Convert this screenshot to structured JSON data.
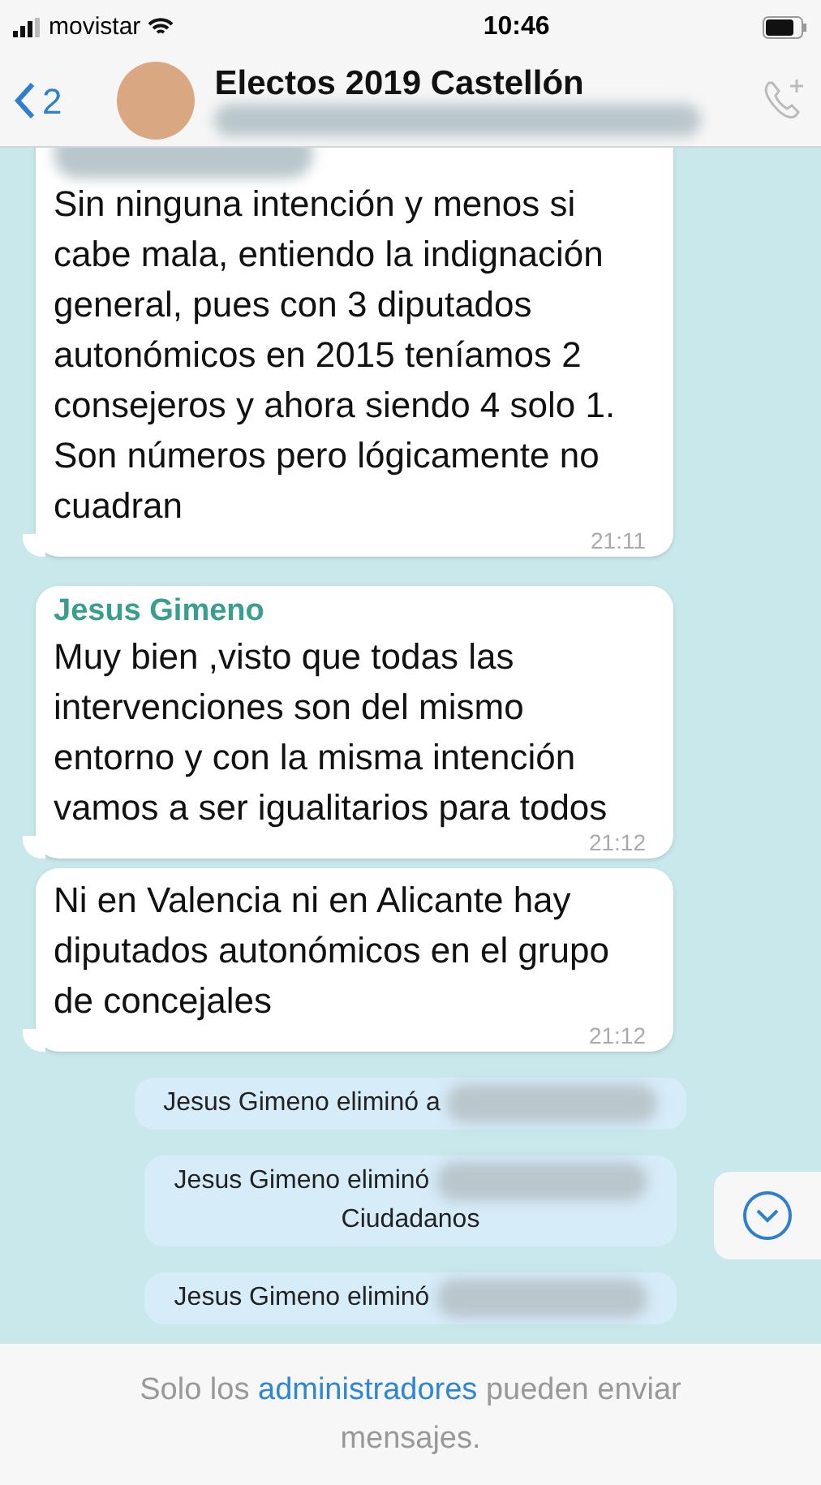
{
  "status_bar": {
    "carrier": "movistar",
    "time": "10:46"
  },
  "header": {
    "back_count": "2",
    "title": "Electos 2019 Castellón"
  },
  "messages": [
    {
      "kind": "incoming",
      "sender_hidden": true,
      "text": "Sin ninguna intención y menos si cabe mala, entiendo la indignación general, pues con 3 diputados autonómicos en 2015 teníamos 2 consejeros y ahora siendo 4 solo 1. Son números pero lógicamente no cuadran",
      "time": "21:11"
    },
    {
      "kind": "incoming",
      "sender": "Jesus Gimeno",
      "text": "Muy bien ,visto que todas las intervenciones son del mismo entorno y con la misma intención vamos a ser igualitarios para todos",
      "time": "21:12"
    },
    {
      "kind": "incoming",
      "text": "Ni en Valencia ni en Alicante hay diputados autonómicos en el grupo de concejales",
      "time": "21:12"
    },
    {
      "kind": "system",
      "text": "Jesus Gimeno eliminó a"
    },
    {
      "kind": "system",
      "text": "Jesus Gimeno eliminó",
      "second_line": "Ciudadanos"
    },
    {
      "kind": "system",
      "text": "Jesus Gimeno eliminó"
    }
  ],
  "footer": {
    "before": "Solo los",
    "link": "administradores",
    "after": "pueden enviar mensajes."
  }
}
